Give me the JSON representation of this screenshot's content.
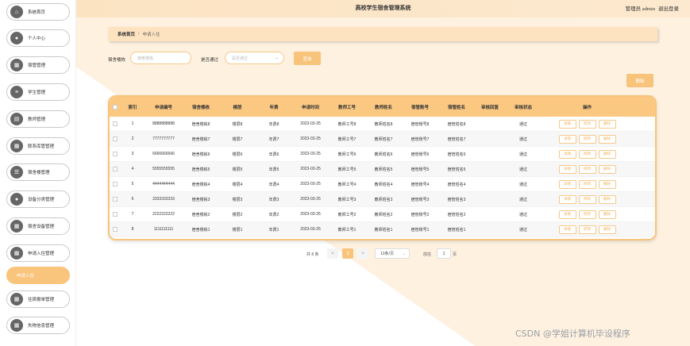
{
  "app": {
    "title": "高校学生宿舍管理系统",
    "user": "管理员 admin",
    "logout": "退出登录"
  },
  "sidebar": {
    "items": [
      {
        "label": "系统首页",
        "icon": "home-icon",
        "glyph": "⌂"
      },
      {
        "label": "个人中心",
        "icon": "user-icon",
        "glyph": "●"
      },
      {
        "label": "宿管管理",
        "icon": "grid-icon",
        "glyph": "▦"
      },
      {
        "label": "学生管理",
        "icon": "list-icon",
        "glyph": "≡"
      },
      {
        "label": "教师管理",
        "icon": "book-icon",
        "glyph": "▤"
      },
      {
        "label": "联系库管管理",
        "icon": "grid-icon",
        "glyph": "▦"
      },
      {
        "label": "宿舍楼管理",
        "icon": "menu-icon",
        "glyph": "☰"
      },
      {
        "label": "设备分类管理",
        "icon": "bulb-icon",
        "glyph": "●"
      },
      {
        "label": "宿舍设备管理",
        "icon": "grid-icon",
        "glyph": "▦"
      },
      {
        "label": "申请入住管理",
        "icon": "grid-icon",
        "glyph": "▦"
      },
      {
        "label": "申请入住",
        "icon": "",
        "glyph": ""
      },
      {
        "label": "住宿报单管理",
        "icon": "grid-icon",
        "glyph": "▦"
      },
      {
        "label": "失物信息管理",
        "icon": "grid-icon",
        "glyph": "▦"
      }
    ],
    "active_index": 10
  },
  "breadcrumb": {
    "home": "系统首页",
    "separator": "/",
    "current": "申请入住"
  },
  "search": {
    "building_label": "宿舍楼栋",
    "building_placeholder": "宿舍楼栋",
    "status_label": "是否通过",
    "status_placeholder": "是否通过",
    "query_button": "查询",
    "delete_button": "删除"
  },
  "table": {
    "columns": [
      "索引",
      "申请编号",
      "宿舍楼栋",
      "楼层",
      "年费",
      "申请时间",
      "教师工号",
      "教师姓名",
      "宿管账号",
      "宿管姓名",
      "审核回复",
      "审核状态",
      "操作"
    ],
    "actions": [
      "详情",
      "修改",
      "删除"
    ],
    "rows": [
      [
        "1",
        "8888888888",
        "宿舍楼栋8",
        "楼层8",
        "年费8",
        "2023-03-25",
        "教师工号8",
        "教师姓名8",
        "宿管账号8",
        "宿管姓名8",
        "",
        "通过"
      ],
      [
        "2",
        "7777777777",
        "宿舍楼栋7",
        "楼层7",
        "年费7",
        "2023-03-25",
        "教师工号7",
        "教师姓名7",
        "宿管账号7",
        "宿管姓名7",
        "",
        "通过"
      ],
      [
        "3",
        "6666666666",
        "宿舍楼栋6",
        "楼层6",
        "年费6",
        "2023-03-25",
        "教师工号6",
        "教师姓名6",
        "宿管账号6",
        "宿管姓名6",
        "",
        "通过"
      ],
      [
        "4",
        "5555555555",
        "宿舍楼栋5",
        "楼层5",
        "年费5",
        "2023-03-25",
        "教师工号5",
        "教师姓名5",
        "宿管账号5",
        "宿管姓名5",
        "",
        "通过"
      ],
      [
        "5",
        "4444444444",
        "宿舍楼栋4",
        "楼层4",
        "年费4",
        "2023-03-25",
        "教师工号4",
        "教师姓名4",
        "宿管账号4",
        "宿管姓名4",
        "",
        "通过"
      ],
      [
        "6",
        "3333333333",
        "宿舍楼栋3",
        "楼层3",
        "年费3",
        "2023-03-25",
        "教师工号3",
        "教师姓名3",
        "宿管账号3",
        "宿管姓名3",
        "",
        "通过"
      ],
      [
        "7",
        "2222222222",
        "宿舍楼栋2",
        "楼层2",
        "年费2",
        "2023-03-25",
        "教师工号2",
        "教师姓名2",
        "宿管账号2",
        "宿管姓名2",
        "",
        "通过"
      ],
      [
        "8",
        "1111111111",
        "宿舍楼栋1",
        "楼层1",
        "年费1",
        "2023-03-25",
        "教师工号1",
        "教师姓名1",
        "宿管账号1",
        "宿管姓名1",
        "",
        "通过"
      ]
    ]
  },
  "pagination": {
    "total": "共 8 条",
    "prev": "<",
    "current_page": "1",
    "next": ">",
    "page_size": "10条/页",
    "goto_label": "前往",
    "goto_value": "1",
    "page_suffix": "页"
  },
  "watermark": "CSDN @学姐计算机毕设程序",
  "colors": {
    "accent": "#f9c47c",
    "header_bg": "#fbc882",
    "topbar_bg": "#fbe3c2"
  }
}
